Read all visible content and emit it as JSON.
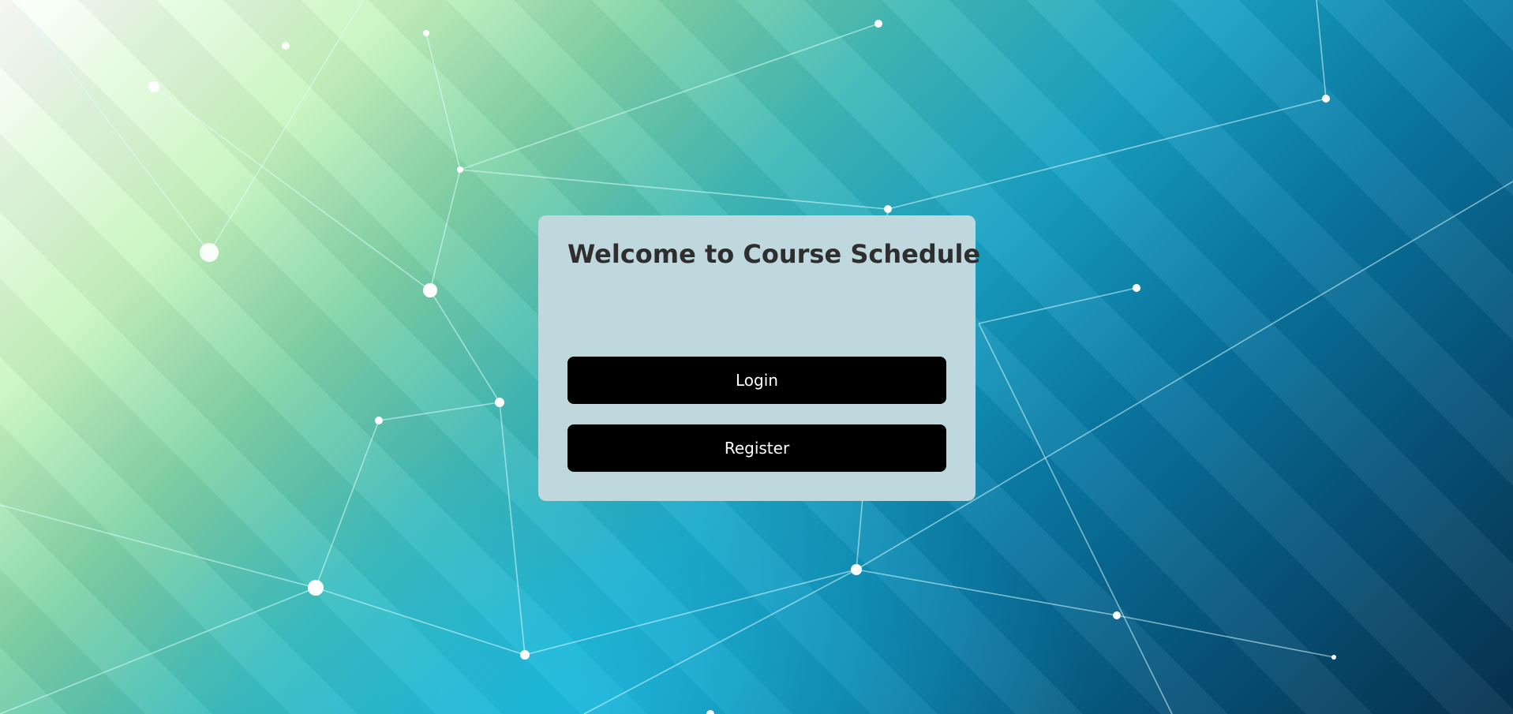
{
  "page": {
    "heading": "Welcome to Course Schedule"
  },
  "actions": {
    "login_label": "Login",
    "register_label": "Register"
  },
  "colors": {
    "card_background": "#bed8de",
    "button_background": "#000000",
    "button_text": "#ffffff",
    "heading_text": "#2e2e2e"
  }
}
